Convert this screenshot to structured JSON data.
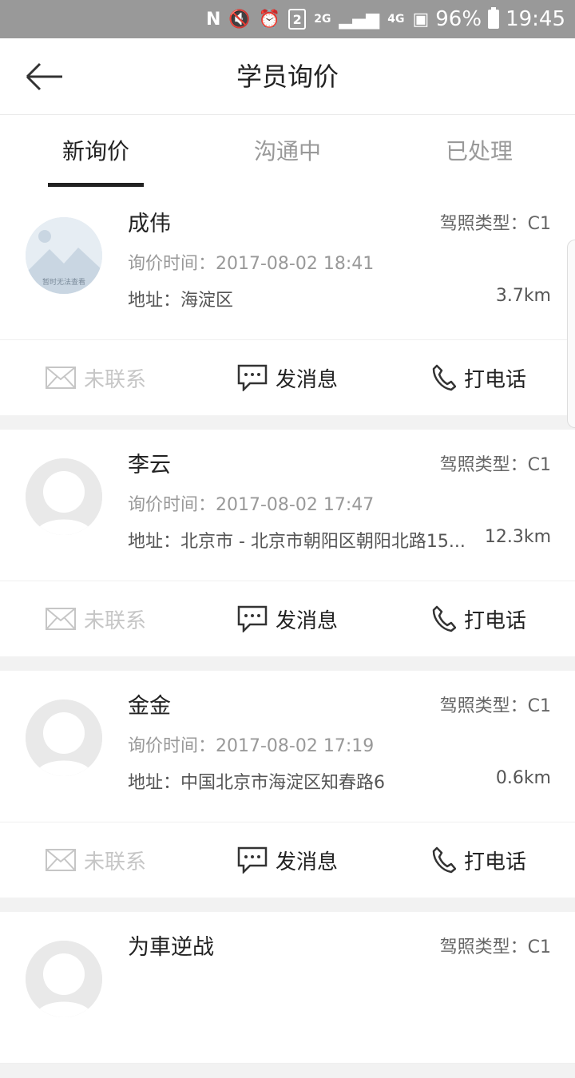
{
  "status_bar": {
    "sim": "2",
    "network_2g": "2G",
    "network_4g": "4G",
    "battery": "96%",
    "time": "19:45"
  },
  "header": {
    "title": "学员询价"
  },
  "tabs": [
    {
      "label": "新询价",
      "active": true
    },
    {
      "label": "沟通中",
      "active": false
    },
    {
      "label": "已处理",
      "active": false
    }
  ],
  "inquiries": [
    {
      "name": "成伟",
      "license": "驾照类型：C1",
      "time": "询价时间：2017-08-02 18:41",
      "address": "地址：海淀区",
      "distance": "3.7km",
      "avatar": "placeholder-image",
      "avatar_text": "暂时无法查看",
      "actions": {
        "status": "未联系",
        "message": "发消息",
        "call": "打电话"
      }
    },
    {
      "name": "李云",
      "license": "驾照类型：C1",
      "time": "询价时间：2017-08-02 17:47",
      "address": "地址：北京市 - 北京市朝阳区朝阳北路15...",
      "distance": "12.3km",
      "avatar": "default-user",
      "actions": {
        "status": "未联系",
        "message": "发消息",
        "call": "打电话"
      }
    },
    {
      "name": "金金",
      "license": "驾照类型：C1",
      "time": "询价时间：2017-08-02 17:19",
      "address": "地址：中国北京市海淀区知春路6",
      "distance": "0.6km",
      "avatar": "default-user",
      "actions": {
        "status": "未联系",
        "message": "发消息",
        "call": "打电话"
      }
    },
    {
      "name": "为車逆战",
      "license": "驾照类型：C1",
      "time": "",
      "address": "",
      "distance": "",
      "avatar": "default-user",
      "actions": {
        "status": "",
        "message": "",
        "call": ""
      }
    }
  ],
  "colors": {
    "status_bar": "#999999",
    "text_primary": "#222222",
    "text_muted": "#999999",
    "disabled": "#c6c6c6"
  }
}
